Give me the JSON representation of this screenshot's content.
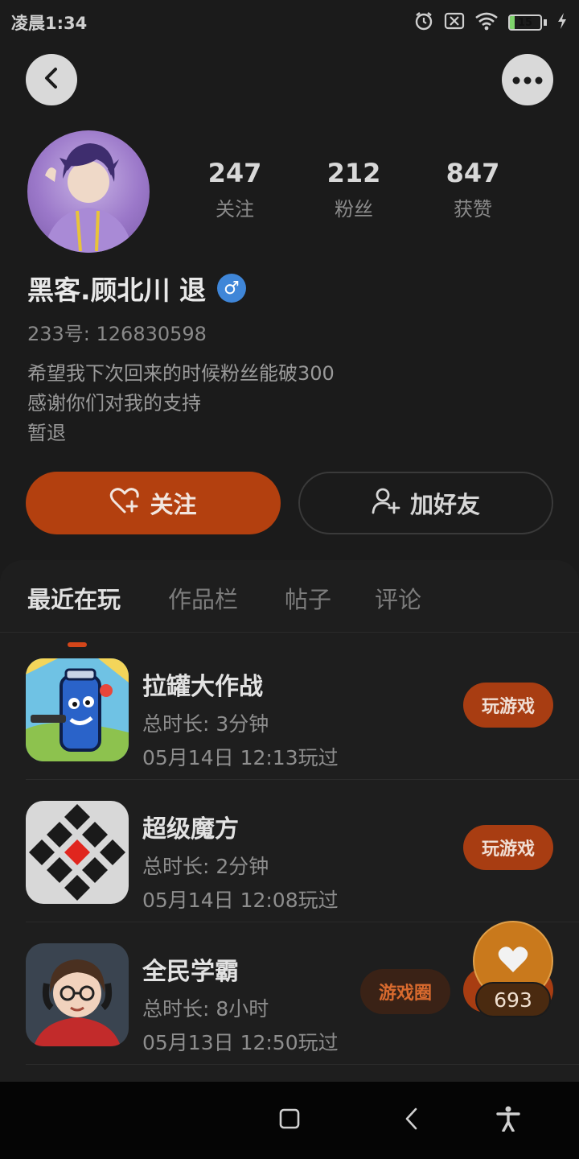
{
  "status_bar": {
    "time": "凌晨1:34",
    "battery_level": "15",
    "battery_fraction": 0.15,
    "icons": [
      "alarm-icon",
      "sim-off-icon",
      "wifi-icon",
      "battery-icon",
      "charging-icon"
    ]
  },
  "header": {
    "back_icon": "chevron-left-icon",
    "more_icon": "more-horizontal-icon"
  },
  "profile": {
    "stats": [
      {
        "value": "247",
        "label": "关注"
      },
      {
        "value": "212",
        "label": "粉丝"
      },
      {
        "value": "847",
        "label": "获赞"
      }
    ],
    "nickname": "黑客.顾北川 退",
    "gender_symbol": "♂",
    "uid": "233号: 126830598",
    "bio_lines": [
      "希望我下次回来的时候粉丝能破300",
      "感谢你们对我的支持",
      "暂退"
    ]
  },
  "actions": {
    "follow_label": "关注",
    "add_friend_label": "加好友"
  },
  "tabs": [
    "最近在玩",
    "作品栏",
    "帖子",
    "评论"
  ],
  "games": [
    {
      "title": "拉罐大作战",
      "duration": "总时长: 3分钟",
      "last_played": "05月14日 12:13玩过",
      "play_label": "玩游戏"
    },
    {
      "title": "超级魔方",
      "duration": "总时长: 2分钟",
      "last_played": "05月14日 12:08玩过",
      "play_label": "玩游戏"
    },
    {
      "title": "全民学霸",
      "duration": "总时长: 8小时",
      "last_played": "05月13日 12:50玩过",
      "circle_label": "游戏圈",
      "play_label": "玩游戏"
    }
  ],
  "like_float": {
    "count": "693"
  },
  "colors": {
    "accent": "#b3400f",
    "background": "#1b1b1b",
    "gender": "#3f86d8",
    "like_bubble": "#c9791c"
  }
}
